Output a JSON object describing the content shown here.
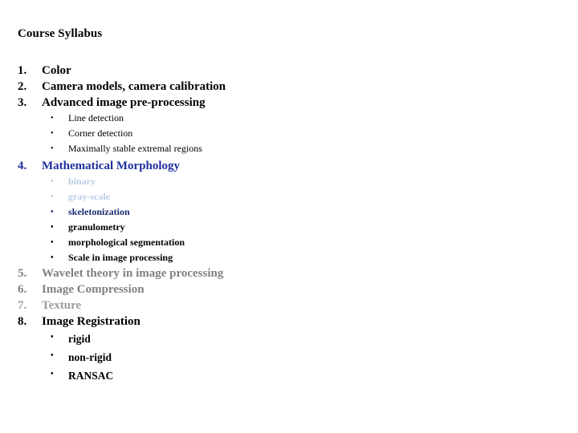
{
  "slide": {
    "title": "Course Syllabus",
    "background_color": "#ffffff"
  },
  "colors": {
    "black": "#000000",
    "blue": "#1f2f9e",
    "navy": "#1b2a72",
    "pale_blue": "#b9cde4",
    "gray_mid": "#808080",
    "gray_light": "#9d9d9d"
  },
  "outline": [
    {
      "number": "1.",
      "label": "Color",
      "color": "#000000",
      "children": []
    },
    {
      "number": "2.",
      "label": "Camera models, camera calibration",
      "color": "#000000",
      "children": []
    },
    {
      "number": "3.",
      "label": "Advanced image pre-processing",
      "color": "#000000",
      "children": [
        {
          "bullet": "•",
          "label": "Line detection",
          "color": "#000000"
        },
        {
          "bullet": "•",
          "label": "Corner detection",
          "color": "#000000"
        },
        {
          "bullet": "•",
          "label": "Maximally stable extremal regions",
          "color": "#000000"
        }
      ]
    },
    {
      "number": "4.",
      "label": "Mathematical Morphology",
      "color": "#1f2f9e",
      "children": [
        {
          "bullet": "•",
          "label": "binary",
          "color": "#b9cde4"
        },
        {
          "bullet": "•",
          "label": "gray-scale",
          "color": "#b9cde4"
        },
        {
          "bullet": "•",
          "label": "skeletonization",
          "color": "#1b2a72"
        },
        {
          "bullet": "•",
          "label": "granulometry",
          "color": "#000000"
        },
        {
          "bullet": "•",
          "label": "morphological segmentation",
          "color": "#000000"
        },
        {
          "bullet": "•",
          "label": "Scale in image processing",
          "color": "#000000"
        }
      ]
    },
    {
      "number": "5.",
      "label": "Wavelet theory in image processing",
      "color": "#808080",
      "children": []
    },
    {
      "number": "6.",
      "label": "Image Compression",
      "color": "#808080",
      "children": []
    },
    {
      "number": "7.",
      "label": "Texture",
      "color": "#9d9d9d",
      "children": []
    },
    {
      "number": "8.",
      "label": "Image Registration",
      "color": "#000000",
      "children": [
        {
          "bullet": "•",
          "label": "rigid",
          "color": "#000000"
        },
        {
          "bullet": "•",
          "label": "non-rigid",
          "color": "#000000"
        },
        {
          "bullet": "•",
          "label": "RANSAC",
          "color": "#000000"
        }
      ]
    }
  ]
}
